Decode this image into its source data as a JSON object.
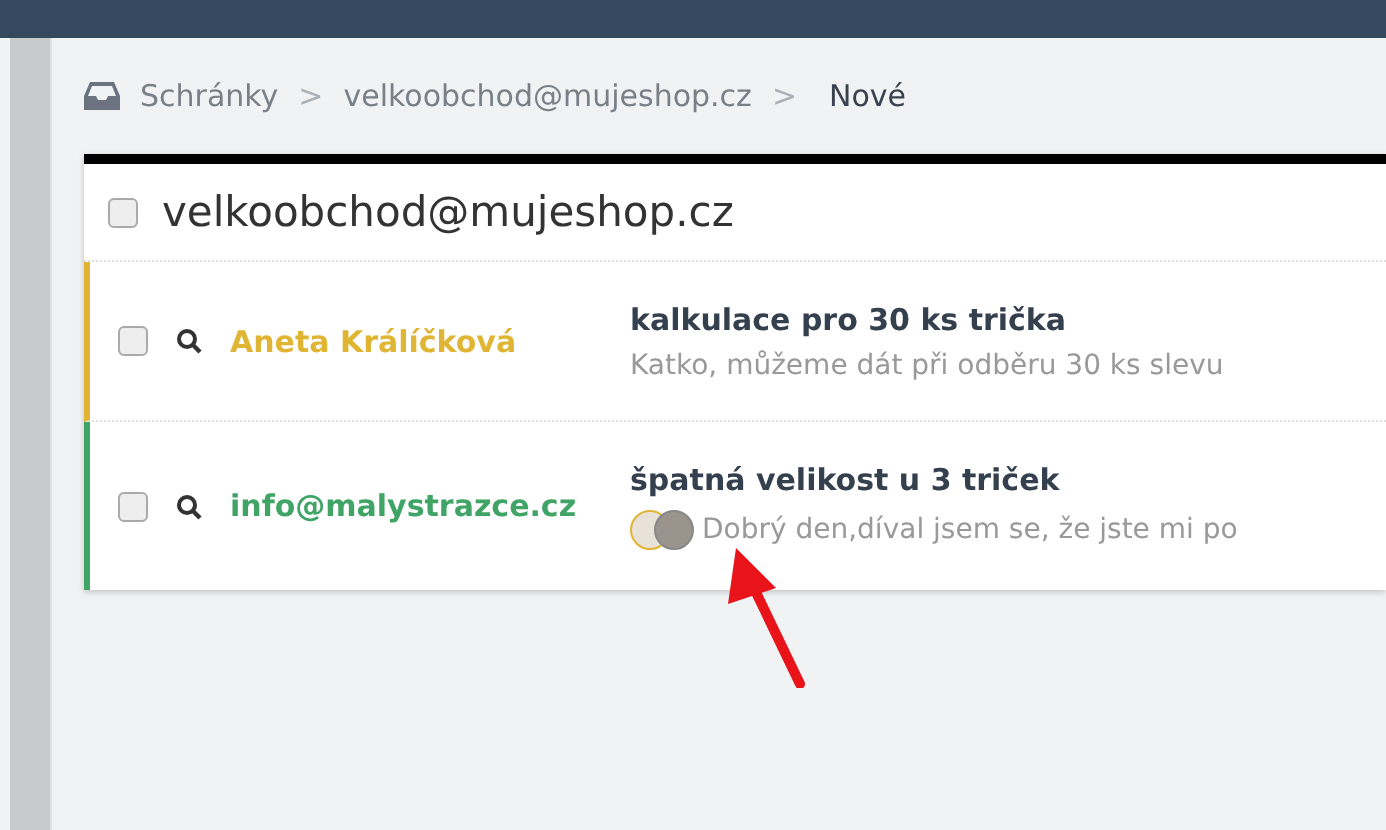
{
  "breadcrumb": [
    {
      "label": "Schránky",
      "current": false
    },
    {
      "label": "velkoobchod@mujeshop.cz",
      "current": false
    },
    {
      "label": "Nové",
      "current": true
    }
  ],
  "breadcrumb_separator": ">",
  "mailbox": {
    "title": "velkoobchod@mujeshop.cz",
    "checked": false
  },
  "messages": [
    {
      "sender": "Aneta Králíčková",
      "color": "#e0b534",
      "checked": false,
      "subject": "kalkulace pro 30 ks trička",
      "preview": "Katko, můžeme dát při odběru 30 ks slevu"
    },
    {
      "sender": "info@malystrazce.cz",
      "color": "#3fa466",
      "checked": false,
      "subject": "špatná velikost u 3 triček",
      "preview": "Dobrý den,díval jsem se, že jste mi po",
      "avatars": [
        {
          "color": "#e0b534"
        },
        {
          "color": "#888888"
        }
      ]
    }
  ]
}
